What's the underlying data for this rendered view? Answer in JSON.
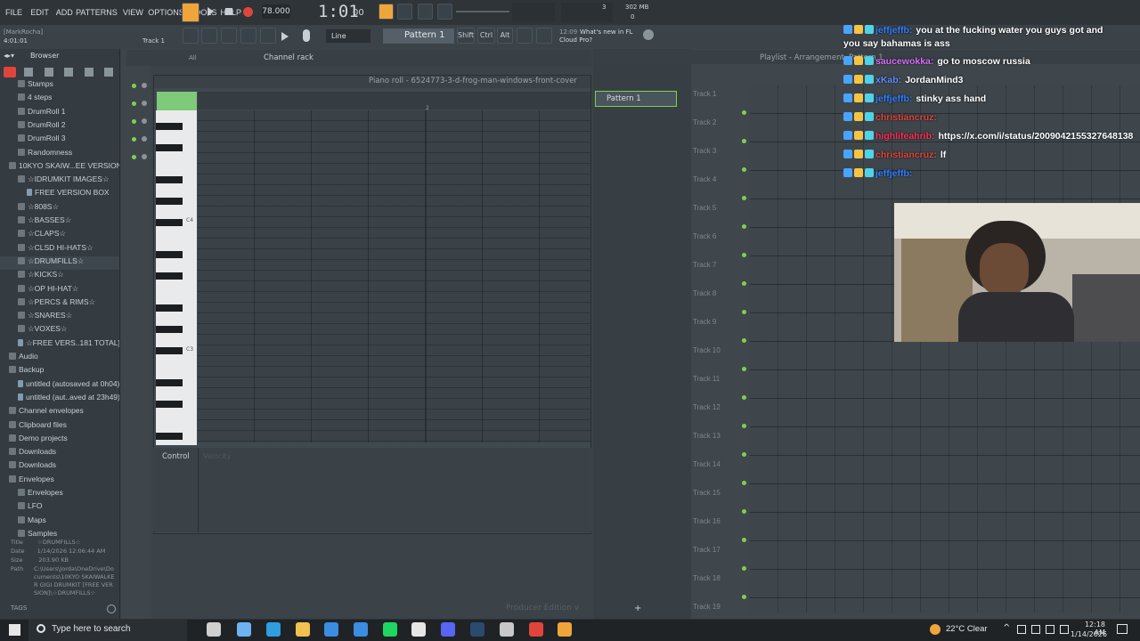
{
  "menu": [
    "FILE",
    "EDIT",
    "ADD",
    "PATTERNS",
    "VIEW",
    "OPTIONS",
    "TOOLS",
    "HELP"
  ],
  "transport": {
    "tempo": "78.000",
    "time": "1:01",
    "time_sub": "00",
    "cpu_top": "3",
    "mem": "302 MB",
    "cpu_bottom": "0"
  },
  "hint": {
    "user": "[MarkRocha]",
    "position": "4:01:01",
    "track": "Track 1"
  },
  "toolbar": {
    "snap": "Line",
    "pattern": "Pattern 1",
    "shift": "Shift",
    "ctrl": "Ctrl",
    "alt": "Alt",
    "news_time": "12:09",
    "news_title": "What's new in FL",
    "news_sub": "Cloud Pro?"
  },
  "browser": {
    "title": "Browser",
    "filter": "All",
    "rows": [
      {
        "label": "Stamps",
        "kind": "folder",
        "indent": 1
      },
      {
        "label": "4 steps",
        "kind": "folder",
        "indent": 1
      },
      {
        "label": "DrumRoll 1",
        "kind": "folder",
        "indent": 1
      },
      {
        "label": "DrumRoll 2",
        "kind": "folder",
        "indent": 1
      },
      {
        "label": "DrumRoll 3",
        "kind": "folder",
        "indent": 1
      },
      {
        "label": "Randomness",
        "kind": "folder",
        "indent": 1
      },
      {
        "label": "10KYO SKAIW...EE VERSION]",
        "kind": "folder",
        "indent": 0
      },
      {
        "label": "☆IDRUMKIT IMAGES☆",
        "kind": "folder",
        "indent": 1
      },
      {
        "label": "FREE VERSION BOX",
        "kind": "file",
        "indent": 2
      },
      {
        "label": "☆808S☆",
        "kind": "folder",
        "indent": 1
      },
      {
        "label": "☆BASSES☆",
        "kind": "folder",
        "indent": 1
      },
      {
        "label": "☆CLAPS☆",
        "kind": "folder",
        "indent": 1
      },
      {
        "label": "☆CLSD HI-HATS☆",
        "kind": "folder",
        "indent": 1
      },
      {
        "label": "☆DRUMFILLS☆",
        "kind": "folder",
        "indent": 1
      },
      {
        "label": "☆KICKS☆",
        "kind": "folder",
        "indent": 1
      },
      {
        "label": "☆OP HI-HAT☆",
        "kind": "folder",
        "indent": 1
      },
      {
        "label": "☆PERCS & RIMS☆",
        "kind": "folder",
        "indent": 1
      },
      {
        "label": "☆SNARES☆",
        "kind": "folder",
        "indent": 1
      },
      {
        "label": "☆VOXES☆",
        "kind": "folder",
        "indent": 1
      },
      {
        "label": "☆FREE VERS..181 TOTAL]☆",
        "kind": "file",
        "indent": 1
      },
      {
        "label": "Audio",
        "kind": "folder",
        "indent": 0
      },
      {
        "label": "Backup",
        "kind": "folder",
        "indent": 0
      },
      {
        "label": "untitled (autosaved at 0h04)",
        "kind": "file",
        "indent": 1
      },
      {
        "label": "untitled (aut..aved at 23h49)",
        "kind": "file",
        "indent": 1
      },
      {
        "label": "Channel envelopes",
        "kind": "folder",
        "indent": 0
      },
      {
        "label": "Clipboard files",
        "kind": "folder",
        "indent": 0
      },
      {
        "label": "Demo projects",
        "kind": "folder",
        "indent": 0
      },
      {
        "label": "Downloads",
        "kind": "folder",
        "indent": 0
      },
      {
        "label": "Downloads",
        "kind": "folder",
        "indent": 0
      },
      {
        "label": "Envelopes",
        "kind": "folder",
        "indent": 0
      },
      {
        "label": "Envelopes",
        "kind": "folder",
        "indent": 1
      },
      {
        "label": "LFO",
        "kind": "folder",
        "indent": 1
      },
      {
        "label": "Maps",
        "kind": "folder",
        "indent": 1
      },
      {
        "label": "Samples",
        "kind": "folder",
        "indent": 1
      }
    ],
    "status": {
      "title_k": "Title",
      "title_v": "☆DRUMFILLS☆",
      "date_k": "Date",
      "date_v": "1/14/2026 12:06:44 AM",
      "size_k": "Size",
      "size_v": "203.90 KB",
      "path_k": "Path",
      "path_v": "C:\\Users\\Jorda\\OneDrive\\Documents\\10KYO SKAIWALKER GIGI DRUMKIT [FREE VERSION]\\☆DRUMFILLS☆"
    },
    "tags": "TAGS"
  },
  "channel_rack": {
    "title": "Channel rack",
    "filter": "All"
  },
  "piano_roll": {
    "title": "Piano roll - 6524773-3-d-frog-man-windows-front-cover",
    "bar2": "2",
    "c4": "C4",
    "c3": "C3",
    "control": "Control",
    "velocity": "Velocity"
  },
  "pattern_list": {
    "item": "Pattern 1"
  },
  "playlist": {
    "title": "Playlist - Arrangement",
    "pattern": "Pattern 1",
    "tracks": [
      "Track 1",
      "Track 2",
      "Track 3",
      "Track 4",
      "Track 5",
      "Track 6",
      "Track 7",
      "Track 8",
      "Track 9",
      "Track 10",
      "Track 11",
      "Track 12",
      "Track 13",
      "Track 14",
      "Track 15",
      "Track 16",
      "Track 17",
      "Track 18",
      "Track 19"
    ]
  },
  "edition": "Producer Edition v",
  "chat": [
    {
      "user": "jeffjeffb:",
      "msg": "you at the fucking water you guys got and",
      "color": "#2f7fff"
    },
    {
      "user": "",
      "msg": "you say bahamas is ass",
      "color": "#ffffff"
    },
    {
      "user": "saucewokka:",
      "msg": "go to moscow russia",
      "color": "#d970ff"
    },
    {
      "user": "xKab:",
      "msg": "JordanMind3",
      "color": "#5f8fff"
    },
    {
      "user": "jeffjeffb:",
      "msg": "stinky ass hand",
      "color": "#2f7fff"
    },
    {
      "user": "christiancruz:",
      "msg": "",
      "color": "#e0453b"
    },
    {
      "user": "highlifeahrib:",
      "msg": "https://x.com/i/status/2009042155327648138",
      "color": "#ff2d55"
    },
    {
      "user": "christiancruz:",
      "msg": "lf",
      "color": "#e0453b"
    },
    {
      "user": "jeffjeffb:",
      "msg": "",
      "color": "#2f7fff"
    }
  ],
  "taskbar": {
    "search": "Type here to search",
    "weather": "22°C  Clear",
    "time": "12:18 AM",
    "date": "1/14/2026"
  },
  "colors": {
    "accent": "#7fd14b",
    "bg": "#3b4248"
  }
}
